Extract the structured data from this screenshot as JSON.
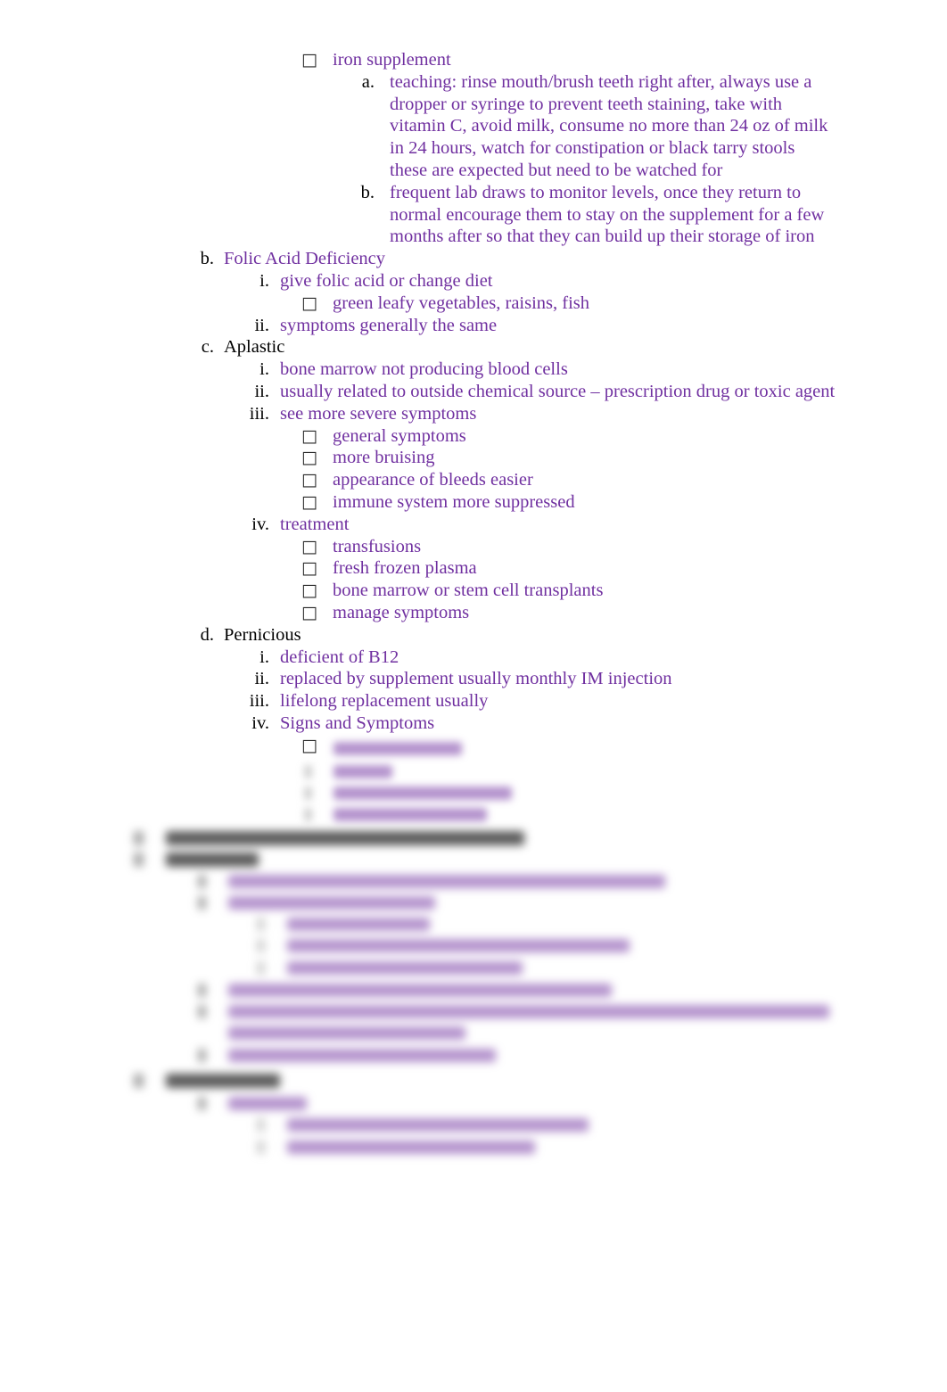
{
  "document": {
    "title": "Anemia Study Notes Outline",
    "text_color": "#7030A0",
    "marker_color": "#000000",
    "background": "#ffffff",
    "bullet_glyph": "□"
  },
  "outline": {
    "iron_supplement": {
      "bullet": "□",
      "label": "iron supplement",
      "items": [
        {
          "marker": "a.",
          "text": "teaching: rinse mouth/brush teeth right after, always use a dropper or syringe to prevent teeth staining, take with vitamin C, avoid milk, consume no more than 24 oz of milk in 24 hours, watch for constipation or black tarry stools these are expected but need to be watched for"
        },
        {
          "marker": "b.",
          "text": "frequent lab draws to monitor levels, once they return to normal encourage them to stay on the supplement for a few months after so that they can build up their storage of iron"
        }
      ]
    },
    "folic_acid": {
      "marker": "b.",
      "label": "Folic Acid Deficiency",
      "children": [
        {
          "marker": "i.",
          "text": "give folic acid or change diet"
        },
        {
          "bullet": "□",
          "text": "green leafy vegetables, raisins, fish"
        },
        {
          "marker": "ii.",
          "text": "symptoms generally the same"
        }
      ]
    },
    "aplastic": {
      "marker": "c.",
      "label": "Aplastic",
      "children": [
        {
          "marker": "i.",
          "text": "bone marrow not producing blood cells"
        },
        {
          "marker": "ii.",
          "text": "usually related to outside chemical source – prescription drug or toxic agent"
        },
        {
          "marker": "iii.",
          "text": "see more severe symptoms"
        },
        {
          "bullet": "□",
          "text": "general symptoms"
        },
        {
          "bullet": "□",
          "text": "more bruising"
        },
        {
          "bullet": "□",
          "text": "appearance of bleeds easier"
        },
        {
          "bullet": "□",
          "text": "immune system more suppressed"
        },
        {
          "marker": "iv.",
          "text": "treatment"
        },
        {
          "bullet": "□",
          "text": "transfusions"
        },
        {
          "bullet": "□",
          "text": "fresh frozen plasma"
        },
        {
          "bullet": "□",
          "text": "bone marrow or stem cell transplants"
        },
        {
          "bullet": "□",
          "text": "manage symptoms"
        }
      ]
    },
    "pernicious": {
      "marker": "d.",
      "label": "Pernicious",
      "children": [
        {
          "marker": "i.",
          "text": "deficient of B12"
        },
        {
          "marker": "ii.",
          "text": "replaced by supplement usually monthly IM injection"
        },
        {
          "marker": "iii.",
          "text": "lifelong replacement usually"
        },
        {
          "marker": "iv.",
          "text": "Signs and Symptoms"
        },
        {
          "bullet": "□",
          "text": ""
        }
      ]
    }
  },
  "blurred_region": {
    "note": "Lower portion of the page is out of focus and illegible.",
    "legible": false
  }
}
